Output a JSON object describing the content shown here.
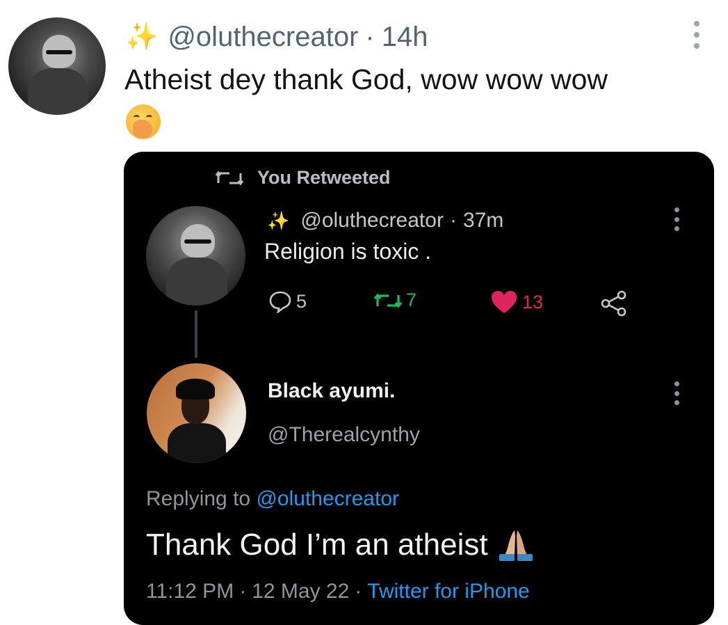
{
  "outer_tweet": {
    "sparkle_icon": "sparkles-icon",
    "handle": "@oluthecreator",
    "separator": "·",
    "time": "14h",
    "text": "Atheist dey thank God, wow wow wow",
    "emoji": "face-with-hand-over-mouth-emoji"
  },
  "embedded": {
    "retweet_label": "You Retweeted",
    "original": {
      "handle": "@oluthecreator",
      "separator": "·",
      "time": "37m",
      "text": "Religion is toxic .",
      "reply_count": "5",
      "retweet_count": "7",
      "like_count": "13"
    },
    "reply": {
      "name": "Black ayumi.",
      "handle": "@Therealcynthy",
      "replying_prefix": "Replying to",
      "replying_to": "@oluthecreator",
      "text": "Thank God I’m an atheist",
      "emoji": "folded-hands-emoji",
      "time": "11:12 PM",
      "date": "12 May 22",
      "separator": "·",
      "source": "Twitter for iPhone"
    }
  },
  "colors": {
    "retweet_green": "#17bf63",
    "like_pink": "#e0245e",
    "link_blue": "#1d9bf0"
  }
}
